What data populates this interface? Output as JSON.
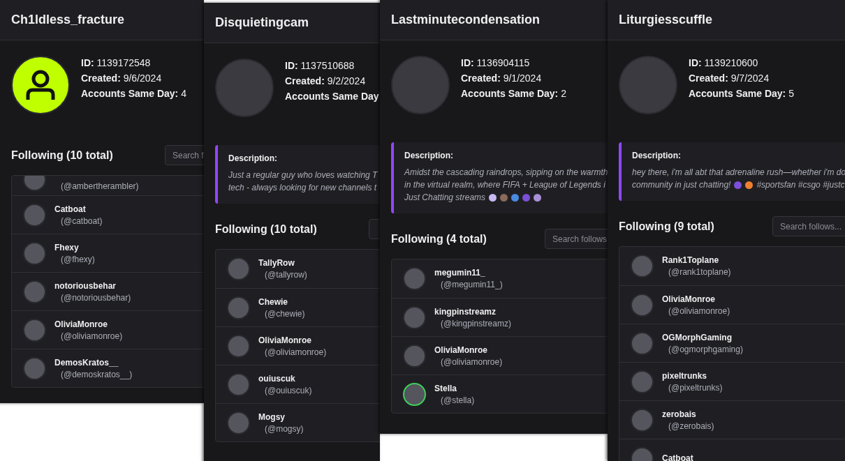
{
  "panels": [
    {
      "title": "Ch1ldless_fracture",
      "avatar": {
        "kind": "icon"
      },
      "info": [
        {
          "label": "ID:",
          "value": "1139172548"
        },
        {
          "label": "Created:",
          "value": "9/6/2024"
        },
        {
          "label": "Accounts Same Day:",
          "value": "4"
        }
      ],
      "following": {
        "heading": "Following (10 total)",
        "placeholder": "Search f",
        "rows": [
          {
            "handle": "(@ambertherambler)",
            "partial": true,
            "live": false
          },
          {
            "name": "Catboat",
            "handle": "(@catboat)",
            "partial": false,
            "live": false
          },
          {
            "name": "Fhexy",
            "handle": "(@fhexy)",
            "partial": false,
            "live": false
          },
          {
            "name": "notoriousbehar",
            "handle": "(@notoriousbehar)",
            "partial": false,
            "live": false
          },
          {
            "name": "OliviaMonroe",
            "handle": "(@oliviamonroe)",
            "partial": false,
            "live": false
          },
          {
            "name": "DemosKratos__",
            "handle": "(@demoskratos__)",
            "partial": false,
            "live": false
          }
        ]
      }
    },
    {
      "title": "Disquietingcam",
      "avatar": {
        "kind": "picture"
      },
      "info": [
        {
          "label": "ID:",
          "value": "1137510688"
        },
        {
          "label": "Created:",
          "value": "9/2/2024"
        },
        {
          "label": "Accounts Same Day"
        }
      ],
      "description": {
        "label": "Description:",
        "lines": [
          [
            {
              "kind": "text",
              "text": "Just a regular guy who loves watching T"
            }
          ],
          [
            {
              "kind": "text",
              "text": "tech - always looking for new channels t"
            }
          ]
        ]
      },
      "following": {
        "heading": "Following (10 total)",
        "rows": [
          {
            "name": "TallyRow",
            "handle": "(@tallyrow)",
            "partial": false,
            "live": false
          },
          {
            "name": "Chewie",
            "handle": "(@chewie)",
            "partial": false,
            "live": false
          },
          {
            "name": "OliviaMonroe",
            "handle": "(@oliviamonroe)",
            "partial": false,
            "live": false
          },
          {
            "name": "ouiuscuk",
            "handle": "(@ouiuscuk)",
            "partial": false,
            "live": false
          },
          {
            "name": "Mogsy",
            "handle": "(@mogsy)",
            "partial": false,
            "live": false
          }
        ]
      }
    },
    {
      "title": "Lastminutecondensation",
      "avatar": {
        "kind": "picture"
      },
      "info": [
        {
          "label": "ID:",
          "value": "1136904115"
        },
        {
          "label": "Created:",
          "value": "9/1/2024"
        },
        {
          "label": "Accounts Same Day:",
          "value": "2"
        }
      ],
      "description": {
        "label": "Description:",
        "lines": [
          [
            {
              "kind": "text",
              "text": "Amidst the cascading raindrops, sipping on the warmth"
            }
          ],
          [
            {
              "kind": "text",
              "text": "in the virtual realm, where FIFA + League of Legends i"
            }
          ],
          [
            {
              "kind": "text",
              "text": "Just Chatting streams"
            },
            {
              "kind": "emoji",
              "color": "#c9b8f0"
            },
            {
              "kind": "emoji",
              "color": "#8a6a5a"
            },
            {
              "kind": "emoji",
              "color": "#4a8ae0"
            },
            {
              "kind": "emoji",
              "color": "#7b4fd8"
            },
            {
              "kind": "emoji",
              "color": "#a890d8"
            }
          ]
        ]
      },
      "following": {
        "heading": "Following (4 total)",
        "placeholder": "Search follows",
        "rows": [
          {
            "name": "megumin11_",
            "handle": "(@megumin11_)",
            "partial": false,
            "live": false
          },
          {
            "name": "kingpinstreamz",
            "handle": "(@kingpinstreamz)",
            "partial": false,
            "live": false
          },
          {
            "name": "OliviaMonroe",
            "handle": "(@oliviamonroe)",
            "partial": false,
            "live": false
          },
          {
            "name": "Stella",
            "handle": "(@stella)",
            "partial": false,
            "live": true
          }
        ]
      }
    },
    {
      "title": "Liturgiesscuffle",
      "avatar": {
        "kind": "picture"
      },
      "info": [
        {
          "label": "ID:",
          "value": "1139210600"
        },
        {
          "label": "Created:",
          "value": "9/7/2024"
        },
        {
          "label": "Accounts Same Day:",
          "value": "5"
        }
      ],
      "description": {
        "label": "Description:",
        "lines": [
          [
            {
              "kind": "text",
              "text": "hey there, i'm all abt that adrenaline rush—whether i'm do"
            }
          ],
          [
            {
              "kind": "text",
              "text": "community in just chatting!"
            },
            {
              "kind": "emoji",
              "color": "#7b4fd8"
            },
            {
              "kind": "emoji",
              "color": "#f08030"
            },
            {
              "kind": "text",
              "text": "#sportsfan #csgo #justc"
            }
          ]
        ]
      },
      "following": {
        "heading": "Following (9 total)",
        "placeholder": "Search follows...",
        "rows": [
          {
            "name": "Rank1Toplane",
            "handle": "(@rank1toplane)",
            "partial": false,
            "live": false
          },
          {
            "name": "OliviaMonroe",
            "handle": "(@oliviamonroe)",
            "partial": false,
            "live": false
          },
          {
            "name": "OGMorphGaming",
            "handle": "(@ogmorphgaming)",
            "partial": false,
            "live": false
          },
          {
            "name": "pixeltrunks",
            "handle": "(@pixeltrunks)",
            "partial": false,
            "live": false
          },
          {
            "name": "zerobais",
            "handle": "(@zerobais)",
            "partial": false,
            "live": false
          },
          {
            "name": "Catboat",
            "partial": false,
            "live": false
          }
        ]
      }
    }
  ]
}
